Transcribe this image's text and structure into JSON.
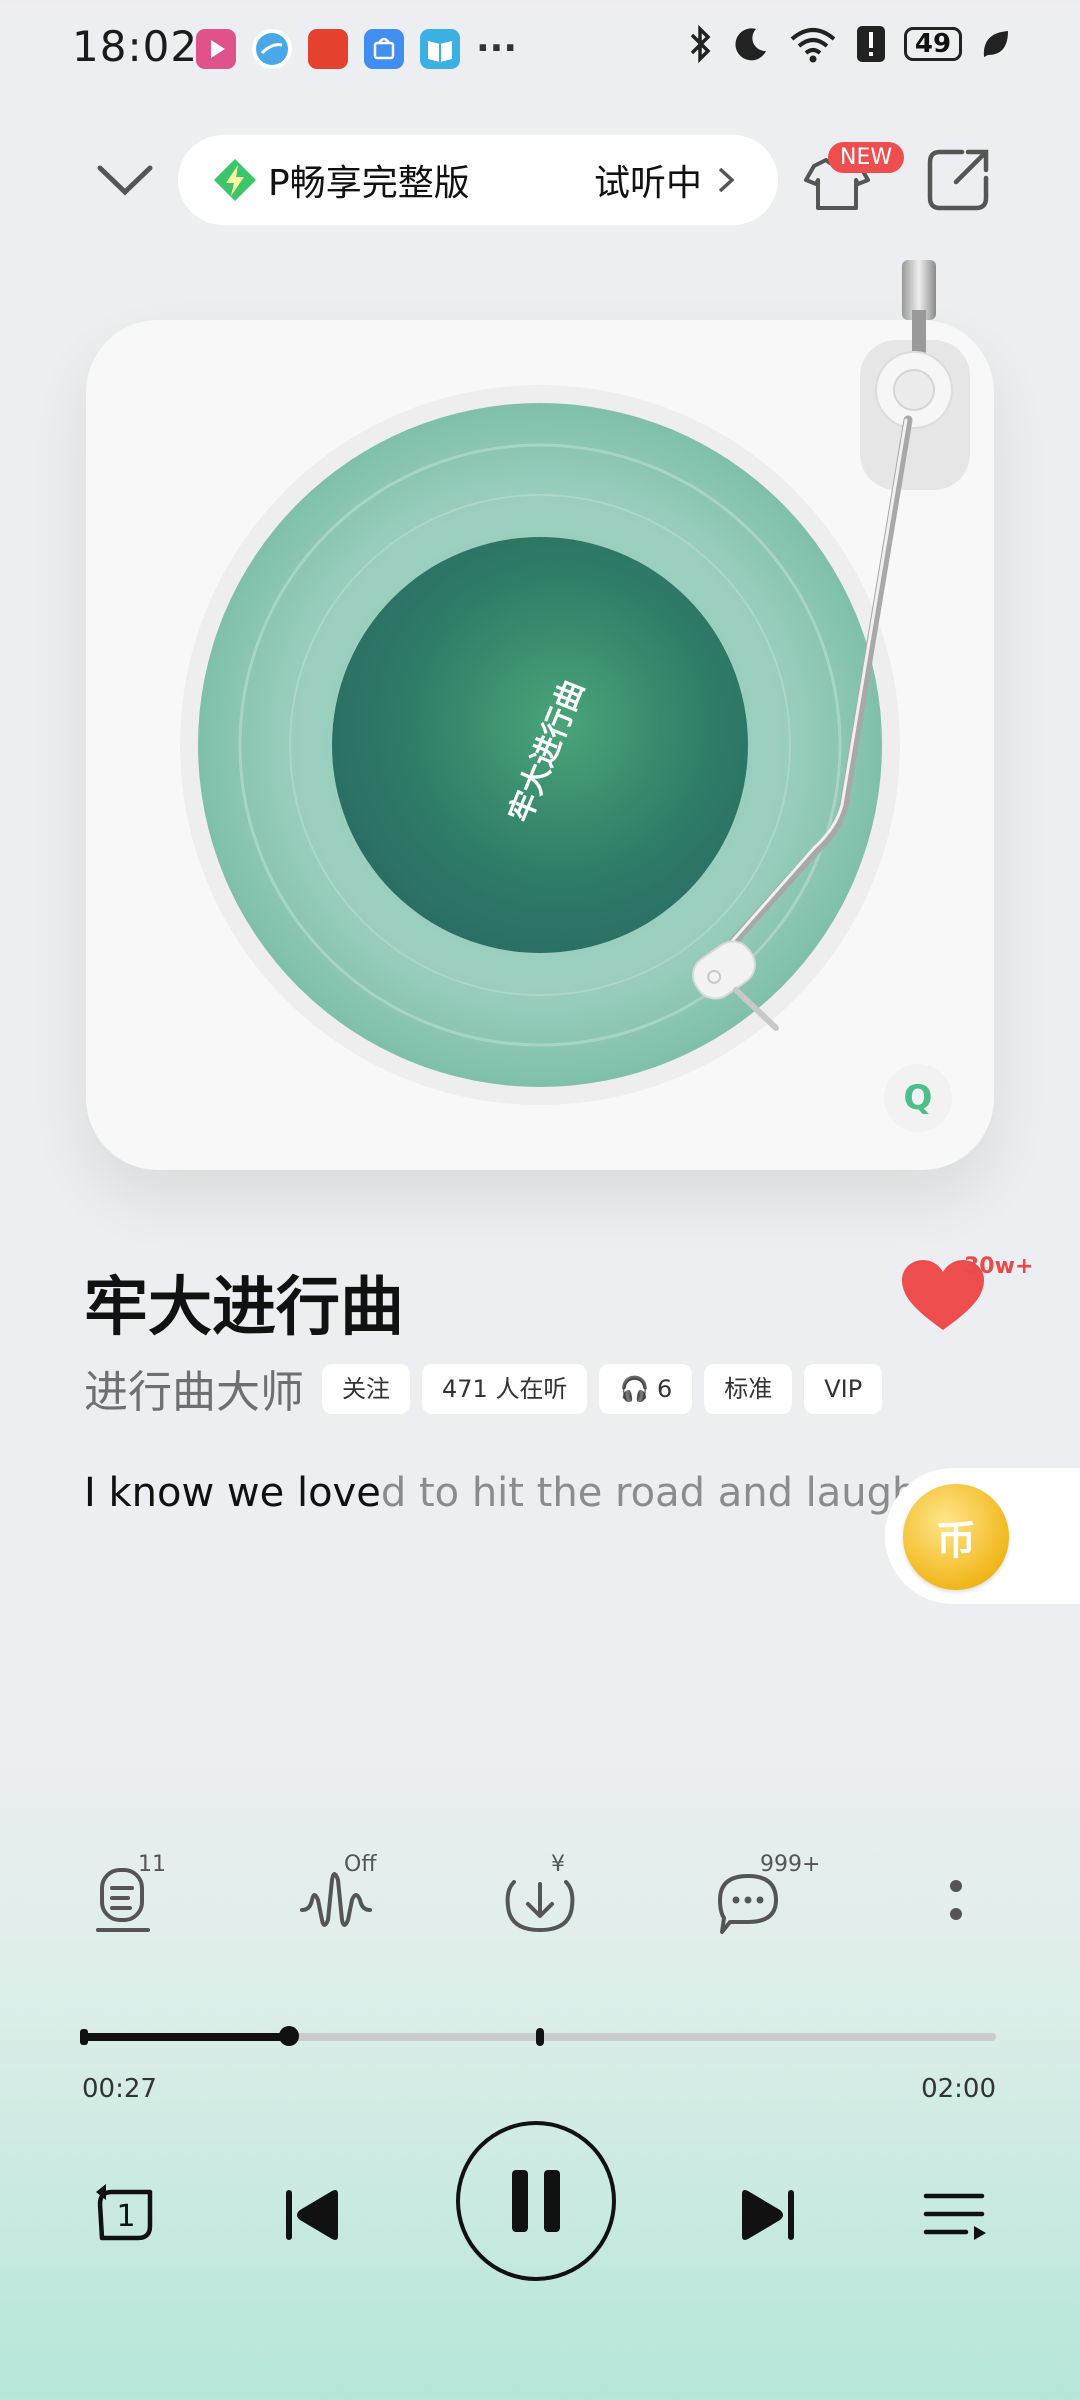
{
  "status_bar": {
    "time": "18:02",
    "more_apps": "···",
    "battery": "49",
    "app_icons": [
      {
        "name": "video-app-icon",
        "color": "#e0538a"
      },
      {
        "name": "browser-app-icon",
        "color": "#4aa7ea"
      },
      {
        "name": "shopping-app-icon",
        "color": "#e5412f"
      },
      {
        "name": "app-store-icon",
        "color": "#3f8ef0"
      },
      {
        "name": "reader-app-icon",
        "color": "#3bb0e3"
      }
    ]
  },
  "header": {
    "banner_text": "P畅享完整版",
    "banner_trial": "试听中",
    "theme_badge": "NEW"
  },
  "player": {
    "record_label": "牢大进行曲",
    "accent_color": "#5fb79a",
    "logo": "Q"
  },
  "song": {
    "title": "牢大进行曲",
    "artist": "进行曲大师",
    "like_count": "30w+",
    "tags": [
      {
        "label": "关注"
      },
      {
        "label": "471 人在听"
      },
      {
        "label": "🎧 6"
      },
      {
        "label": "标准"
      },
      {
        "label": "VIP"
      }
    ]
  },
  "lyric": {
    "sung": "I know we love",
    "unsung": "d to hit the road and laugh"
  },
  "coin": {
    "symbol": "币"
  },
  "actions": [
    {
      "name": "lyrics-icon",
      "badge": "11"
    },
    {
      "name": "sound-effect-icon",
      "badge": "Off"
    },
    {
      "name": "download-icon",
      "badge": "¥"
    },
    {
      "name": "comment-icon",
      "badge": "999+"
    },
    {
      "name": "more-icon",
      "badge": ""
    }
  ],
  "progress": {
    "current": "00:27",
    "total": "02:00",
    "fraction": 0.225,
    "marker_fraction": 0.5
  },
  "controls": {
    "repeat_mode": "1"
  }
}
